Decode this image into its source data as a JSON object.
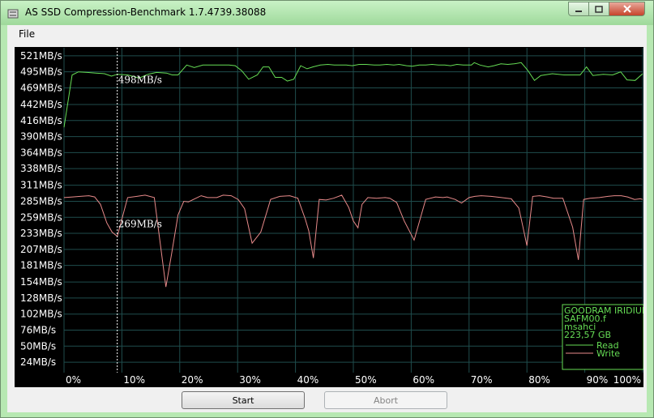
{
  "window": {
    "title": "AS SSD Compression-Benchmark 1.7.4739.38088"
  },
  "menu": {
    "file_label": "File"
  },
  "buttons": {
    "start_label": "Start",
    "abort_label": "Abort"
  },
  "colors": {
    "read": "#66dd55",
    "write": "#e88a8a",
    "grid": "#1f4d4d",
    "background": "#000000"
  },
  "legend": {
    "lines": [
      "GOODRAM IRIDIUM",
      "SAFM00.f",
      "msahci",
      "223,57 GB"
    ],
    "read_label": "Read",
    "write_label": "Write"
  },
  "chart_data": {
    "type": "line",
    "y_tick_labels": [
      "521MB/s",
      "495MB/s",
      "469MB/s",
      "442MB/s",
      "416MB/s",
      "390MB/s",
      "364MB/s",
      "338MB/s",
      "311MB/s",
      "285MB/s",
      "259MB/s",
      "233MB/s",
      "207MB/s",
      "181MB/s",
      "154MB/s",
      "128MB/s",
      "102MB/s",
      "76MB/s",
      "50MB/s",
      "24MB/s"
    ],
    "y_ticks": [
      521,
      495,
      469,
      442,
      416,
      390,
      364,
      338,
      311,
      285,
      259,
      233,
      207,
      181,
      154,
      128,
      102,
      76,
      50,
      24
    ],
    "x_tick_labels": [
      "0%",
      "10%",
      "20%",
      "30%",
      "40%",
      "50%",
      "60%",
      "70%",
      "80%",
      "90%",
      "100%"
    ],
    "x_ticks": [
      0,
      10,
      20,
      30,
      40,
      50,
      60,
      70,
      80,
      90,
      100
    ],
    "ylim": [
      7,
      534
    ],
    "xlim": [
      0,
      100
    ],
    "grid": true,
    "legend_position": "bottom-right",
    "marker": {
      "x": 9.2,
      "read_label": "498MB/s",
      "write_label": "269MB/s"
    },
    "series": [
      {
        "name": "Read",
        "points": [
          [
            0,
            405
          ],
          [
            1.4,
            490
          ],
          [
            2.5,
            495
          ],
          [
            4,
            494
          ],
          [
            5.5,
            493
          ],
          [
            7,
            492
          ],
          [
            8.2,
            488
          ],
          [
            9.2,
            491
          ],
          [
            11,
            490
          ],
          [
            13,
            485
          ],
          [
            14.5,
            491
          ],
          [
            16,
            494
          ],
          [
            17.7,
            493
          ],
          [
            18.7,
            490
          ],
          [
            19.7,
            490
          ],
          [
            21.2,
            506
          ],
          [
            22.5,
            502
          ],
          [
            24,
            506
          ],
          [
            25.5,
            506
          ],
          [
            27,
            506
          ],
          [
            28.5,
            506
          ],
          [
            29.6,
            505
          ],
          [
            30.7,
            497
          ],
          [
            31.9,
            483
          ],
          [
            33.4,
            490
          ],
          [
            34.4,
            503
          ],
          [
            35.4,
            503
          ],
          [
            36.5,
            486
          ],
          [
            37.6,
            486
          ],
          [
            38.6,
            480
          ],
          [
            39.7,
            483
          ],
          [
            40.9,
            505
          ],
          [
            42,
            500
          ],
          [
            43,
            503
          ],
          [
            44.3,
            506
          ],
          [
            45.6,
            507
          ],
          [
            46.7,
            506
          ],
          [
            47.7,
            506
          ],
          [
            48.8,
            506
          ],
          [
            49.8,
            505
          ],
          [
            51,
            507
          ],
          [
            52.2,
            507
          ],
          [
            53.6,
            506
          ],
          [
            54.6,
            506
          ],
          [
            55.8,
            507
          ],
          [
            57,
            506
          ],
          [
            57.9,
            507
          ],
          [
            59.2,
            505
          ],
          [
            60.2,
            504
          ],
          [
            61.4,
            506
          ],
          [
            62.5,
            506
          ],
          [
            63.6,
            507
          ],
          [
            64.7,
            506
          ],
          [
            65.8,
            506
          ],
          [
            66.8,
            505
          ],
          [
            67.9,
            507
          ],
          [
            69,
            506
          ],
          [
            70.4,
            506
          ],
          [
            70.9,
            510
          ],
          [
            71.9,
            506
          ],
          [
            73.3,
            503
          ],
          [
            74.3,
            505
          ],
          [
            75.5,
            508
          ],
          [
            76.7,
            507
          ],
          [
            77.8,
            508
          ],
          [
            79,
            510
          ],
          [
            80.1,
            498
          ],
          [
            81.3,
            481
          ],
          [
            82.4,
            489
          ],
          [
            84.4,
            492
          ],
          [
            86.4,
            490
          ],
          [
            89.2,
            490
          ],
          [
            90.3,
            503
          ],
          [
            91.4,
            489
          ],
          [
            93.2,
            491
          ],
          [
            94.8,
            490
          ],
          [
            96.2,
            495
          ],
          [
            97.3,
            482
          ],
          [
            98.7,
            481
          ],
          [
            100,
            492
          ]
        ]
      },
      {
        "name": "Write",
        "points": [
          [
            0,
            291
          ],
          [
            1.5,
            292
          ],
          [
            2.8,
            293
          ],
          [
            4.3,
            294
          ],
          [
            5.3,
            292
          ],
          [
            6.3,
            280
          ],
          [
            7.4,
            250
          ],
          [
            8.3,
            235
          ],
          [
            9.2,
            228
          ],
          [
            11,
            291
          ],
          [
            12.6,
            293
          ],
          [
            14,
            295
          ],
          [
            15.6,
            291
          ],
          [
            17.6,
            146
          ],
          [
            18.6,
            200
          ],
          [
            19.7,
            263
          ],
          [
            20.7,
            285
          ],
          [
            21.5,
            284
          ],
          [
            22.8,
            290
          ],
          [
            23.7,
            294
          ],
          [
            24.8,
            291
          ],
          [
            26.4,
            291
          ],
          [
            27.5,
            295
          ],
          [
            28.9,
            294
          ],
          [
            30.1,
            288
          ],
          [
            31.2,
            273
          ],
          [
            32.5,
            217
          ],
          [
            34,
            235
          ],
          [
            35.7,
            288
          ],
          [
            37.3,
            293
          ],
          [
            39,
            294
          ],
          [
            40.4,
            290
          ],
          [
            41.7,
            256
          ],
          [
            42.3,
            237
          ],
          [
            43.1,
            193
          ],
          [
            44.1,
            288
          ],
          [
            45.3,
            287
          ],
          [
            46.6,
            290
          ],
          [
            48,
            295
          ],
          [
            49.2,
            275
          ],
          [
            50,
            253
          ],
          [
            50.8,
            242
          ],
          [
            51.5,
            280
          ],
          [
            52.5,
            291
          ],
          [
            54,
            290
          ],
          [
            55.5,
            291
          ],
          [
            56.3,
            290
          ],
          [
            57.5,
            283
          ],
          [
            58.8,
            253
          ],
          [
            60.5,
            222
          ],
          [
            62.5,
            288
          ],
          [
            64.2,
            292
          ],
          [
            65.5,
            291
          ],
          [
            66.2,
            292
          ],
          [
            67.6,
            288
          ],
          [
            68.7,
            282
          ],
          [
            70,
            291
          ],
          [
            71,
            293
          ],
          [
            72.1,
            294
          ],
          [
            73.8,
            293
          ],
          [
            75.6,
            291
          ],
          [
            77.3,
            289
          ],
          [
            78.6,
            274
          ],
          [
            79.3,
            244
          ],
          [
            80,
            213
          ],
          [
            81,
            293
          ],
          [
            82.2,
            294
          ],
          [
            83.5,
            292
          ],
          [
            84.6,
            290
          ],
          [
            86.2,
            290
          ],
          [
            87.9,
            243
          ],
          [
            88.9,
            190
          ],
          [
            89.8,
            288
          ],
          [
            90.9,
            290
          ],
          [
            92.5,
            291
          ],
          [
            94,
            293
          ],
          [
            95.1,
            294
          ],
          [
            96.3,
            294
          ],
          [
            97.4,
            292
          ],
          [
            98.6,
            288
          ],
          [
            99.6,
            289
          ],
          [
            100,
            288
          ]
        ]
      }
    ]
  }
}
